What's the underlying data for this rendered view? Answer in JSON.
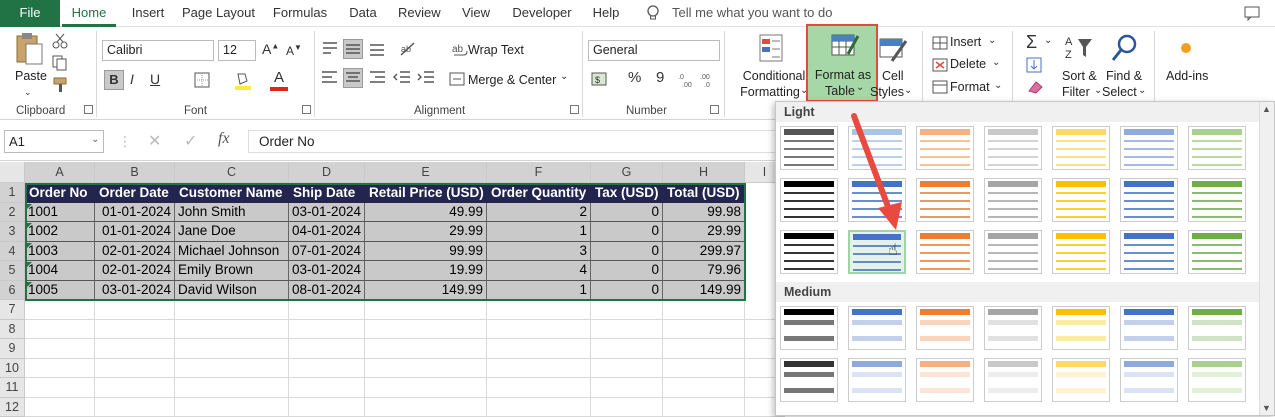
{
  "tabs": [
    "File",
    "Home",
    "Insert",
    "Page Layout",
    "Formulas",
    "Data",
    "Review",
    "View",
    "Developer",
    "Help"
  ],
  "tell_me": "Tell me what you want to do",
  "ribbon": {
    "clipboard": {
      "paste": "Paste",
      "label": "Clipboard"
    },
    "font": {
      "name": "Calibri",
      "size": "12",
      "label": "Font",
      "bold": "B",
      "italic": "I",
      "underline": "U"
    },
    "alignment": {
      "wrap_text": "Wrap Text",
      "merge": "Merge & Center",
      "label": "Alignment"
    },
    "number": {
      "format": "General",
      "percent": "%",
      "comma": "9",
      "label": "Number"
    },
    "styles": {
      "conditional": [
        "Conditional",
        "Formatting"
      ],
      "format_table": [
        "Format as",
        "Table"
      ],
      "cell_styles": [
        "Cell",
        "Styles"
      ]
    },
    "cells": {
      "insert": "Insert",
      "delete": "Delete",
      "format": "Format"
    },
    "editing": {
      "sort": [
        "Sort &",
        "Filter"
      ],
      "find": [
        "Find &",
        "Select"
      ]
    },
    "addins": "Add-ins"
  },
  "formula_bar": {
    "name_box": "A1",
    "fx": "fx",
    "content": "Order No"
  },
  "columns": [
    "A",
    "B",
    "C",
    "D",
    "E",
    "F",
    "G",
    "H",
    "I"
  ],
  "rows": [
    "1",
    "2",
    "3",
    "4",
    "5",
    "6",
    "7",
    "8",
    "9",
    "10",
    "11",
    "12"
  ],
  "table": {
    "headers": [
      "Order No",
      "Order Date",
      "Customer Name",
      "Ship Date",
      "Retail Price (USD)",
      "Order Quantity",
      "Tax (USD)",
      "Total (USD)"
    ],
    "rows": [
      [
        "1001",
        "01-01-2024",
        "John Smith",
        "03-01-2024",
        "49.99",
        "2",
        "0",
        "99.98"
      ],
      [
        "1002",
        "01-01-2024",
        "Jane Doe",
        "04-01-2024",
        "29.99",
        "1",
        "0",
        "29.99"
      ],
      [
        "1003",
        "02-01-2024",
        "Michael Johnson",
        "07-01-2024",
        "99.99",
        "3",
        "0",
        "299.97"
      ],
      [
        "1004",
        "02-01-2024",
        "Emily Brown",
        "03-01-2024",
        "19.99",
        "4",
        "0",
        "79.96"
      ],
      [
        "1005",
        "03-01-2024",
        "David Wilson",
        "08-01-2024",
        "149.99",
        "1",
        "0",
        "149.99"
      ]
    ]
  },
  "gallery": {
    "light": "Light",
    "medium": "Medium"
  },
  "colors": {
    "excel_green": "#217346",
    "header_fill": "#23254f",
    "highlight": "#e04a3f",
    "arrow": "#e84a3f"
  }
}
